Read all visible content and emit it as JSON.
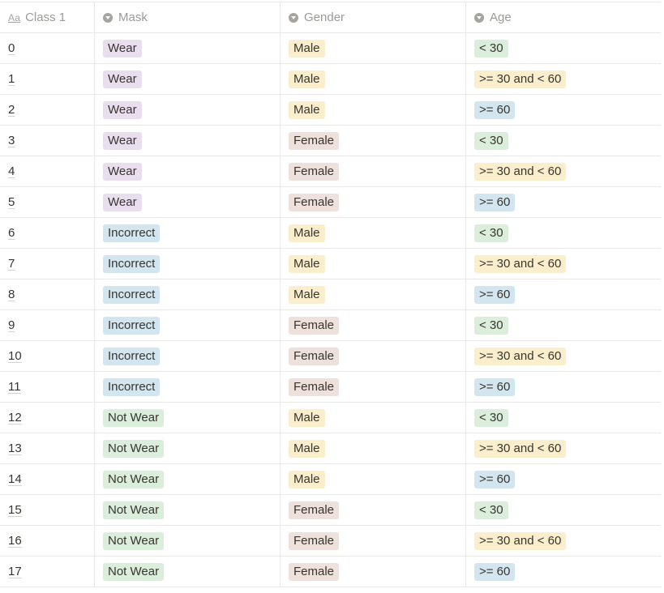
{
  "colors": {
    "Wear": "#e8deee",
    "Incorrect": "#d3e5ef",
    "Not Wear": "#dbeddb",
    "Male": "#fbeecc",
    "Female": "#eee0da",
    "< 30": "#dbeddb",
    ">= 30 and < 60": "#fbeecc",
    ">= 60": "#d3e5ef"
  },
  "headers": {
    "class_icon": "Aa",
    "class": "Class 1",
    "mask": "Mask",
    "gender": "Gender",
    "age": "Age"
  },
  "rows": [
    {
      "class": "0",
      "mask": "Wear",
      "gender": "Male",
      "age": "< 30"
    },
    {
      "class": "1",
      "mask": "Wear",
      "gender": "Male",
      "age": ">= 30 and < 60"
    },
    {
      "class": "2",
      "mask": "Wear",
      "gender": "Male",
      "age": ">= 60"
    },
    {
      "class": "3",
      "mask": "Wear",
      "gender": "Female",
      "age": "< 30"
    },
    {
      "class": "4",
      "mask": "Wear",
      "gender": "Female",
      "age": ">= 30 and < 60"
    },
    {
      "class": "5",
      "mask": "Wear",
      "gender": "Female",
      "age": ">= 60"
    },
    {
      "class": "6",
      "mask": "Incorrect",
      "gender": "Male",
      "age": "< 30"
    },
    {
      "class": "7",
      "mask": "Incorrect",
      "gender": "Male",
      "age": ">= 30 and < 60"
    },
    {
      "class": "8",
      "mask": "Incorrect",
      "gender": "Male",
      "age": ">= 60"
    },
    {
      "class": "9",
      "mask": "Incorrect",
      "gender": "Female",
      "age": "< 30"
    },
    {
      "class": "10",
      "mask": "Incorrect",
      "gender": "Female",
      "age": ">= 30 and < 60"
    },
    {
      "class": "11",
      "mask": "Incorrect",
      "gender": "Female",
      "age": ">= 60"
    },
    {
      "class": "12",
      "mask": "Not Wear",
      "gender": "Male",
      "age": "< 30"
    },
    {
      "class": "13",
      "mask": "Not Wear",
      "gender": "Male",
      "age": ">= 30 and < 60"
    },
    {
      "class": "14",
      "mask": "Not Wear",
      "gender": "Male",
      "age": ">= 60"
    },
    {
      "class": "15",
      "mask": "Not Wear",
      "gender": "Female",
      "age": "< 30"
    },
    {
      "class": "16",
      "mask": "Not Wear",
      "gender": "Female",
      "age": ">= 30 and < 60"
    },
    {
      "class": "17",
      "mask": "Not Wear",
      "gender": "Female",
      "age": ">= 60"
    }
  ]
}
